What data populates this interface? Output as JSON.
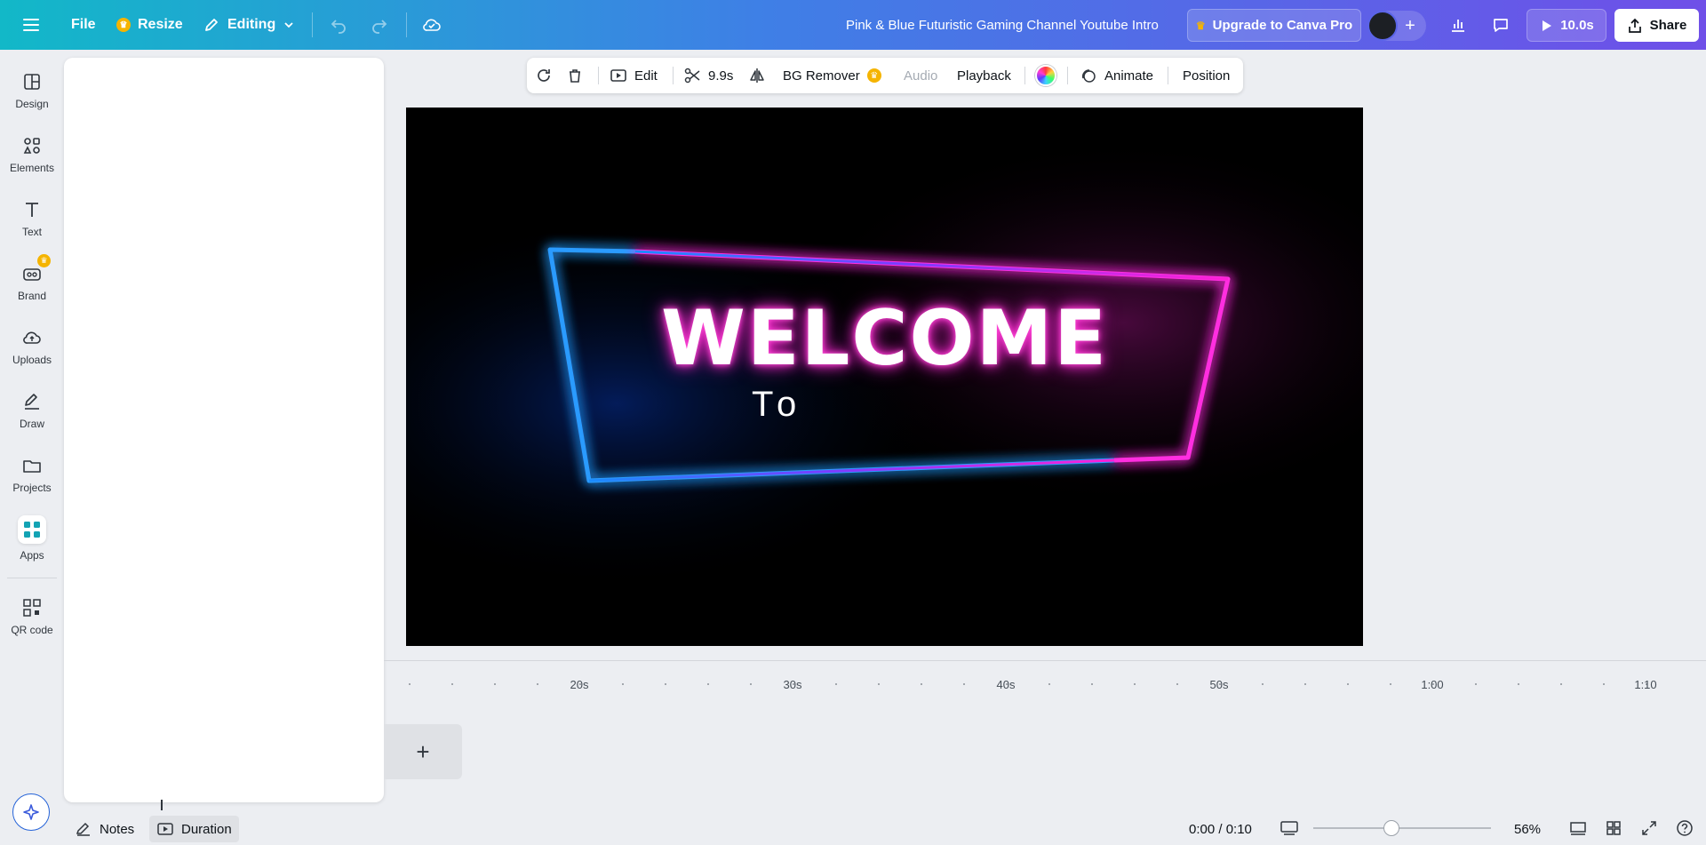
{
  "topbar": {
    "file_label": "File",
    "resize_label": "Resize",
    "editing_label": "Editing",
    "document_title": "Pink & Blue Futuristic Gaming Channel Youtube Intro",
    "upgrade_label": "Upgrade to Canva Pro",
    "play_duration": "10.0s",
    "share_label": "Share"
  },
  "rail": {
    "items": [
      {
        "label": "Design"
      },
      {
        "label": "Elements"
      },
      {
        "label": "Text"
      },
      {
        "label": "Brand"
      },
      {
        "label": "Uploads"
      },
      {
        "label": "Draw"
      },
      {
        "label": "Projects"
      },
      {
        "label": "Apps"
      },
      {
        "label": "QR code"
      }
    ]
  },
  "context_toolbar": {
    "edit_label": "Edit",
    "trim_duration": "9.9s",
    "bg_remover_label": "BG Remover",
    "audio_label": "Audio",
    "playback_label": "Playback",
    "animate_label": "Animate",
    "position_label": "Position"
  },
  "canvas": {
    "headline": "WELCOME",
    "subline": "To"
  },
  "timeline": {
    "ticks": [
      "20s",
      "30s",
      "40s",
      "50s",
      "1:00",
      "1:10"
    ]
  },
  "bottombar": {
    "notes_label": "Notes",
    "duration_label": "Duration",
    "time_readout": "0:00 / 0:10",
    "zoom_level": "56%"
  },
  "colors": {
    "topbar_start": "#12b8c8",
    "topbar_end": "#6f4fe8",
    "neon_blue": "#1a8cff",
    "neon_pink": "#ff1fd6",
    "pro_crown": "#f5b400"
  }
}
